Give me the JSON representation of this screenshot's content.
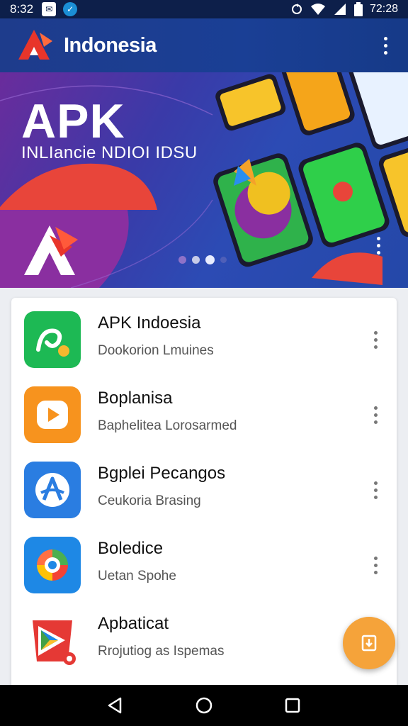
{
  "status_bar": {
    "time": "8:32",
    "right_text": "72:28",
    "icons": [
      "message-icon",
      "app-notification-icon",
      "sync-icon",
      "wifi-icon",
      "signal-icon",
      "battery-icon"
    ]
  },
  "app_bar": {
    "title": "Indonesia",
    "menu_icon": "more-vert-icon"
  },
  "banner": {
    "headline": "APK",
    "tagline": "INLIancie NDIOI IDSU",
    "carousel": {
      "count": 4,
      "active_index": 2
    }
  },
  "apps": [
    {
      "name": "APK Indoesia",
      "subtitle": "Dookorion Lmuines",
      "icon": "location-app-icon",
      "color": "#1db954"
    },
    {
      "name": "Boplanisa",
      "subtitle": "Baphelitea Lorosarmed",
      "icon": "video-play-app-icon",
      "color": "#f7931e"
    },
    {
      "name": "Bgplei Pecangos",
      "subtitle": "Ceukoria Brasing",
      "icon": "letter-a-app-icon",
      "color": "#2a7de1"
    },
    {
      "name": "Boledice",
      "subtitle": "Uetan Spohe",
      "icon": "colorful-circle-app-icon",
      "color": "#1e88e5"
    },
    {
      "name": "Apbaticat",
      "subtitle": "Rrojutiog as Ispemas",
      "icon": "play-store-app-icon",
      "color": "#e53935"
    }
  ],
  "fab_icon": "download-icon",
  "nav": [
    "back-icon",
    "home-icon",
    "recents-icon"
  ]
}
